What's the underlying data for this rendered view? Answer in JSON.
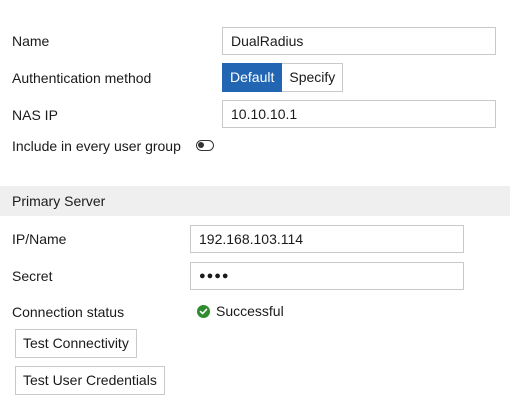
{
  "form": {
    "name_label": "Name",
    "name_value": "DualRadius",
    "auth_label": "Authentication method",
    "auth_options": [
      "Default",
      "Specify"
    ],
    "auth_selected": "Default",
    "nas_label": "NAS IP",
    "nas_value": "10.10.10.1",
    "include_label": "Include in every user group",
    "include_enabled": false
  },
  "primary_server": {
    "section_title": "Primary Server",
    "ip_label": "IP/Name",
    "ip_value": "192.168.103.114",
    "secret_label": "Secret",
    "secret_value": "●●●●",
    "status_label": "Connection status",
    "status_value": "Successful",
    "status_icon": "check-circle-icon",
    "status_color": "#2e8b2e",
    "test_connectivity_label": "Test Connectivity",
    "test_credentials_label": "Test User Credentials"
  },
  "colors": {
    "accent": "#2266b3",
    "section_bg": "#efefef"
  }
}
